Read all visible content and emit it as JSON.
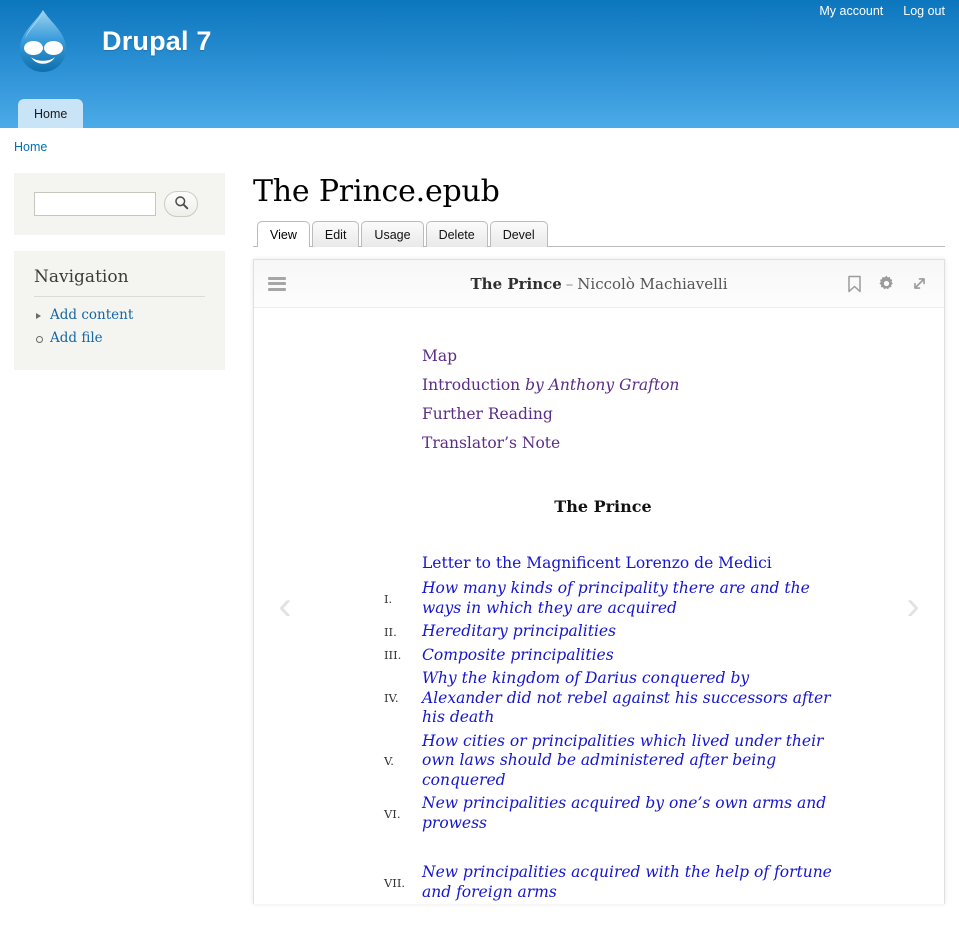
{
  "header": {
    "site_name": "Drupal 7",
    "logo_icon": "drupal-droplet-logo",
    "account_links": [
      {
        "label": "My account"
      },
      {
        "label": "Log out"
      }
    ],
    "primary_tabs": [
      {
        "label": "Home"
      }
    ]
  },
  "breadcrumb": {
    "items": [
      {
        "label": "Home"
      }
    ]
  },
  "sidebar": {
    "search": {
      "value": "",
      "placeholder": "",
      "button_icon": "search-icon"
    },
    "navigation": {
      "title": "Navigation",
      "items": [
        {
          "label": "Add content",
          "bullet": "arrow"
        },
        {
          "label": "Add file",
          "bullet": "circle"
        }
      ]
    }
  },
  "main": {
    "page_title": "The Prince.epub",
    "tabs": [
      {
        "label": "View",
        "active": true
      },
      {
        "label": "Edit",
        "active": false
      },
      {
        "label": "Usage",
        "active": false
      },
      {
        "label": "Delete",
        "active": false
      },
      {
        "label": "Devel",
        "active": false
      }
    ]
  },
  "reader": {
    "menu_icon": "hamburger-menu-icon",
    "book_title": "The Prince",
    "separator": "–",
    "book_author": "Niccolò Machiavelli",
    "icons": [
      {
        "name": "bookmark-icon"
      },
      {
        "name": "settings-gear-icon"
      },
      {
        "name": "fullscreen-expand-icon"
      }
    ],
    "prev_arrow": "‹",
    "next_arrow": "›",
    "front_matter": [
      {
        "text": "Map",
        "italic_suffix": ""
      },
      {
        "text": "Introduction ",
        "italic_suffix": "by Anthony Grafton"
      },
      {
        "text": "Further Reading",
        "italic_suffix": ""
      },
      {
        "text": "Translator’s Note",
        "italic_suffix": ""
      }
    ],
    "section_heading": "The Prince",
    "letter_link": "Letter to the Magnificent Lorenzo de Medici",
    "chapters": [
      {
        "num": "I.",
        "title": "How many kinds of principality there are and the ways in which they are acquired"
      },
      {
        "num": "II.",
        "title": "Hereditary principalities"
      },
      {
        "num": "III.",
        "title": "Composite principalities"
      },
      {
        "num": "IV.",
        "title": "Why the kingdom of Darius conquered by Alexander did not rebel against his successors after his death"
      },
      {
        "num": "V.",
        "title": "How cities or principalities which lived under their own laws should be administered after being conquered"
      },
      {
        "num": "VI.",
        "title": "New principalities acquired by one’s own arms and prowess"
      },
      {
        "num": "VII.",
        "title": "New principalities acquired with the help of fortune and foreign arms"
      }
    ]
  },
  "colors": {
    "header_blue_top": "#0c76bd",
    "header_blue_bottom": "#4cabe8",
    "link_blue": "#1567a5",
    "visited_purple": "#5b2d87",
    "chapter_blue": "#1515cf",
    "block_bg": "#f4f4f0"
  }
}
